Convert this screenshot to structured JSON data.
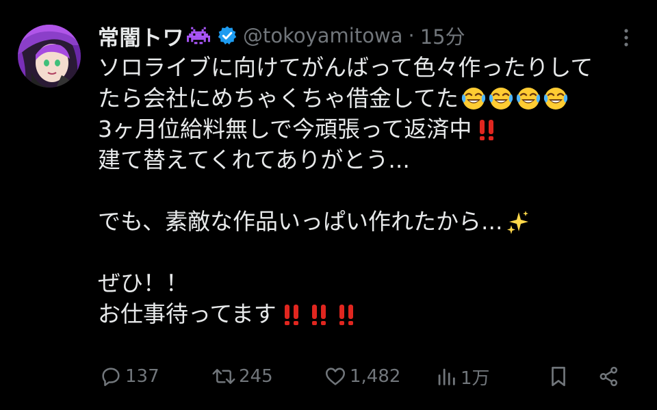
{
  "author": {
    "display_name": "常闇トワ",
    "name_emoji_icon": "space-invader-icon",
    "verified_icon": "verified-badge-icon",
    "handle": "@tokoyamitowa",
    "separator": "·",
    "timestamp": "15分"
  },
  "tweet": {
    "lines": [
      "ソロライブに向けてがんばって色々作ったりして",
      "たら会社にめちゃくちゃ借金してた",
      "3ヶ月位給料無しで今頑張って返済中",
      "建て替えてくれてありがとう...",
      "",
      "でも、素敵な作品いっぱい作れたから...",
      "",
      "ぜひ！！",
      "お仕事待ってます"
    ],
    "emoji": {
      "line2": [
        "joy-tears-icon",
        "joy-tears-icon",
        "joy-tears-icon",
        "joy-tears-icon"
      ],
      "line3": [
        "double-exclamation-icon"
      ],
      "line6": [
        "sparkles-icon"
      ],
      "line9": [
        "double-exclamation-icon",
        "double-exclamation-icon",
        "double-exclamation-icon"
      ]
    }
  },
  "actions": {
    "replies": "137",
    "reposts": "245",
    "likes": "1,482",
    "views": "1万"
  },
  "colors": {
    "background": "#000000",
    "text": "#e7e9ea",
    "muted": "#71767b",
    "verified": "#1d9bf0",
    "exclamation": "#e0261f",
    "emoji_face": "#ffcc33"
  }
}
